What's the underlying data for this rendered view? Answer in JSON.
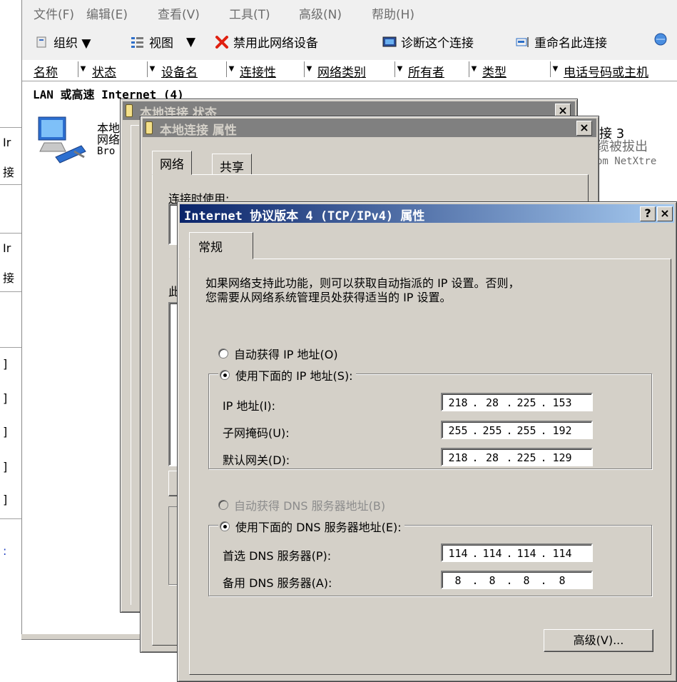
{
  "explorer": {
    "menu": [
      "文件(F)",
      "编辑(E)",
      "查看(V)",
      "工具(T)",
      "高级(N)",
      "帮助(H)"
    ],
    "toolbar": {
      "organize": "组织 ▼",
      "view": "视图",
      "view_arrow": "▼",
      "disable": "禁用此网络设备",
      "diagnose": "诊断这个连接",
      "rename": "重命名此连接"
    },
    "columns": [
      "名称",
      "状态",
      "设备名",
      "连接性",
      "网络类别",
      "所有者",
      "类型",
      "电话号码或主机"
    ],
    "group_title": "LAN 或高速 Internet (4)",
    "adapter_left": {
      "line1": "本地",
      "line2": "网络",
      "line3": "Bro"
    },
    "adapter_right": {
      "line1": "接 3",
      "line2": "缆被拔出",
      "line3": "om NetXtre"
    },
    "left_strip": [
      "Ir",
      "接",
      "Ir",
      "接",
      "]",
      "]",
      "]",
      "]",
      "]",
      ":"
    ]
  },
  "status_dialog": {
    "title": "本地连接 状态"
  },
  "props_dialog": {
    "title": "本地连接 属性",
    "tabs": [
      "网络",
      "共享"
    ],
    "connect_using": "连接时使用:",
    "this_conn": "此"
  },
  "ipv4_dialog": {
    "title": "Internet 协议版本 4 (TCP/IPv4) 属性",
    "help_btn": "?",
    "close_btn": "×",
    "tab": "常规",
    "description_line1": "如果网络支持此功能，则可以获取自动指派的 IP 设置。否则，",
    "description_line2": "您需要从网络系统管理员处获得适当的 IP 设置。",
    "auto_ip": "自动获得 IP 地址(O)",
    "manual_ip": "使用下面的 IP 地址(S):",
    "ip_label": "IP 地址(I):",
    "ip": [
      "218",
      "28",
      "225",
      "153"
    ],
    "mask_label": "子网掩码(U):",
    "mask": [
      "255",
      "255",
      "255",
      "192"
    ],
    "gateway_label": "默认网关(D):",
    "gateway": [
      "218",
      "28",
      "225",
      "129"
    ],
    "auto_dns": "自动获得 DNS 服务器地址(B)",
    "manual_dns": "使用下面的 DNS 服务器地址(E):",
    "dns1_label": "首选 DNS 服务器(P):",
    "dns1": [
      "114",
      "114",
      "114",
      "114"
    ],
    "dns2_label": "备用 DNS 服务器(A):",
    "dns2": [
      "8",
      "8",
      "8",
      "8"
    ],
    "advanced_btn": "高级(V)..."
  },
  "colors": {
    "title_active_start": "#0a246a",
    "title_active_end": "#a6caf0",
    "title_inactive_start": "#808080",
    "title_inactive_end": "#c0c0c0",
    "dialog_face": "#d4d0c8"
  }
}
